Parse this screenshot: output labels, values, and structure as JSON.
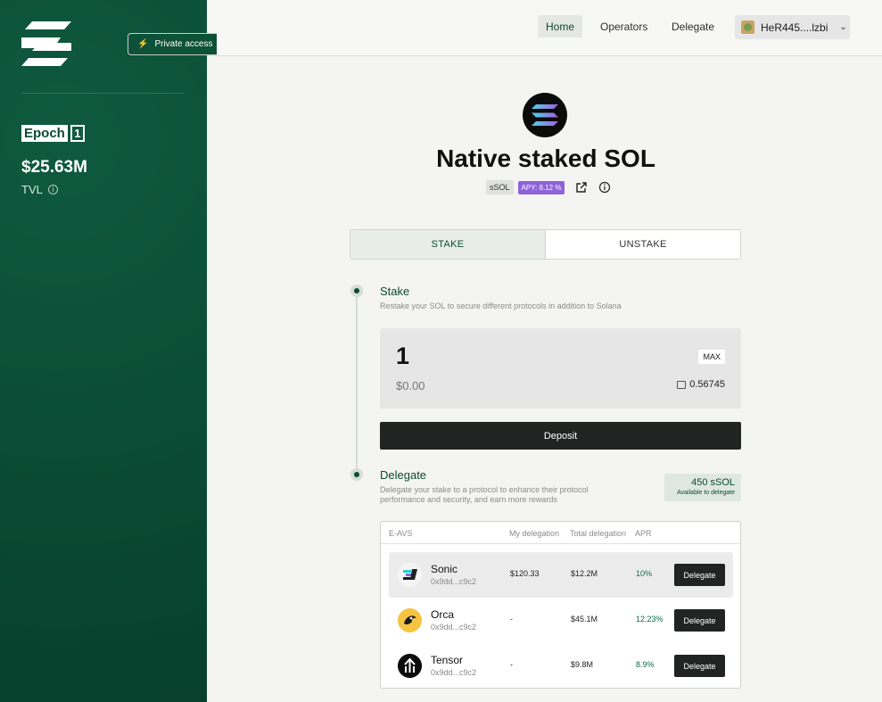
{
  "sidebar": {
    "epoch_label": "Epoch",
    "epoch_number": "1",
    "tvl_value": "$25.63M",
    "tvl_label": "TVL",
    "private_access": "Private access"
  },
  "nav": {
    "home": "Home",
    "operators": "Operators",
    "delegate": "Delegate",
    "wallet": "HeR445....lzbi"
  },
  "hero": {
    "title": "Native staked SOL",
    "tag_symbol": "sSOL",
    "tag_apy": "APY: 8.12 %"
  },
  "tabs": {
    "stake": "STAKE",
    "unstake": "UNSTAKE"
  },
  "stake": {
    "title": "Stake",
    "desc": "Restake your SOL to secure different protocols in addition to Solana",
    "amount": "1",
    "usd": "$0.00",
    "max": "MAX",
    "balance": "0.56745",
    "deposit": "Deposit"
  },
  "delegate": {
    "title": "Delegate",
    "desc_line1": "Delegate your stake to a protocol to enhance their protocol",
    "desc_line2": "performance and security, and earn more rewards",
    "available_amount": "450 sSOL",
    "available_label": "Available to delegate"
  },
  "table": {
    "headers": [
      "E-AVS",
      "My delegation",
      "Total delegation",
      "APR"
    ],
    "rows": [
      {
        "name": "Sonic",
        "address": "0x9dd...c9c2",
        "my_delegation": "$120.33",
        "total": "$12.2M",
        "apr": "10%",
        "action": "Delegate"
      },
      {
        "name": "Orca",
        "address": "0x9dd...c9c2",
        "my_delegation": "-",
        "total": "$45.1M",
        "apr": "12.23%",
        "action": "Delegate"
      },
      {
        "name": "Tensor",
        "address": "0x9dd...c9c2",
        "my_delegation": "-",
        "total": "$9.8M",
        "apr": "8.9%",
        "action": "Delegate"
      }
    ]
  },
  "colors": {
    "sidebar_green": "#0b4a34",
    "accent_purple": "#8e63d8",
    "button_dark": "#222423"
  }
}
